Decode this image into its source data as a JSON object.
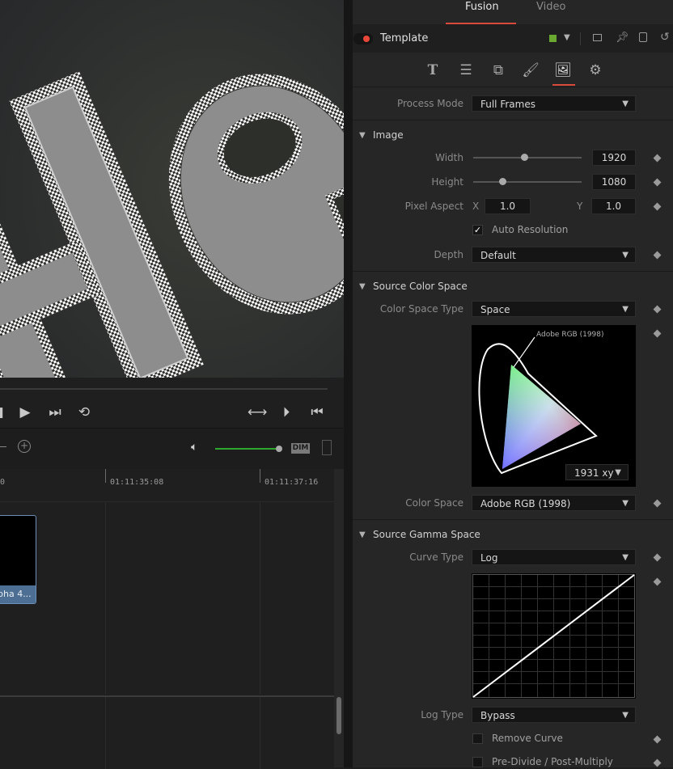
{
  "tabs": {
    "fusion": "Fusion",
    "video": "Video"
  },
  "node": {
    "name": "Template"
  },
  "viewer": {
    "text": "Tle"
  },
  "timeline": {
    "timecodes": [
      "01:11:35:08",
      "01:11:37:16"
    ],
    "timecode_partial": "0",
    "clip_label": "pha 4...",
    "dim_label": "DIM"
  },
  "inspector": {
    "process_mode": {
      "label": "Process Mode",
      "value": "Full Frames"
    },
    "image": {
      "title": "Image",
      "width": {
        "label": "Width",
        "value": "1920",
        "slider": 0.5
      },
      "height": {
        "label": "Height",
        "value": "1080",
        "slider": 0.28
      },
      "pixel_aspect": {
        "label": "Pixel Aspect",
        "x_label": "X",
        "x": "1.0",
        "y_label": "Y",
        "y": "1.0"
      },
      "auto_resolution": {
        "label": "Auto Resolution",
        "checked": true
      },
      "depth": {
        "label": "Depth",
        "value": "Default"
      }
    },
    "source_color_space": {
      "title": "Source Color Space",
      "type": {
        "label": "Color Space Type",
        "value": "Space"
      },
      "gamut_label": "Adobe RGB (1998)",
      "chromaticity": "1931 xy",
      "color_space": {
        "label": "Color Space",
        "value": "Adobe RGB (1998)"
      }
    },
    "source_gamma_space": {
      "title": "Source Gamma Space",
      "curve_type": {
        "label": "Curve Type",
        "value": "Log"
      },
      "log_type": {
        "label": "Log Type",
        "value": "Bypass"
      },
      "remove_curve": {
        "label": "Remove Curve",
        "checked": false
      },
      "pre_divide": {
        "label": "Pre-Divide / Post-Multiply",
        "checked": false
      }
    }
  },
  "colors": {
    "accent": "#d94a3a",
    "node_dot": "#e8473a",
    "lock_green": "#6aa832",
    "clip_bar": "#4d6f93",
    "volume": "#2ea82e"
  }
}
